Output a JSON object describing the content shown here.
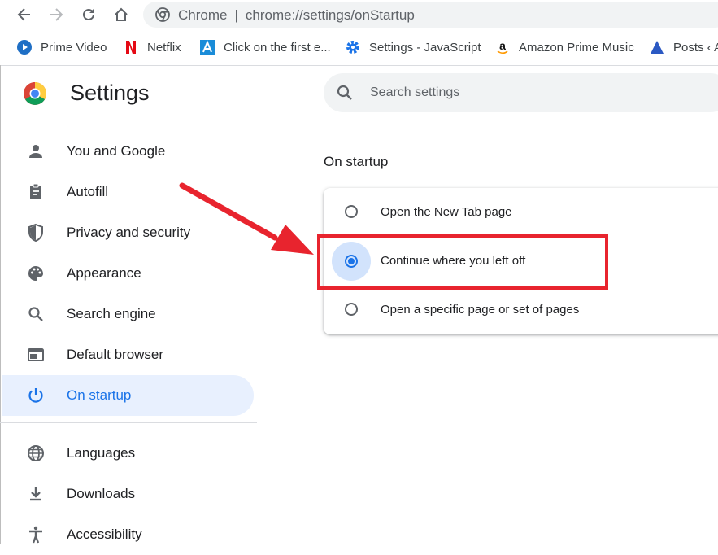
{
  "browser": {
    "omnibox": {
      "site_label": "Chrome",
      "separator": "|",
      "url": "chrome://settings/onStartup"
    },
    "bookmarks": [
      {
        "label": "Prime Video",
        "icon": "prime-video-icon"
      },
      {
        "label": "Netflix",
        "icon": "netflix-icon"
      },
      {
        "label": "Click on the first e...",
        "icon": "letter-a-icon"
      },
      {
        "label": "Settings - JavaScript",
        "icon": "gear-icon"
      },
      {
        "label": "Amazon Prime Music",
        "icon": "amazon-icon"
      },
      {
        "label": "Posts ‹ A",
        "icon": "triangle-icon"
      }
    ]
  },
  "settings": {
    "title": "Settings",
    "search_placeholder": "Search settings",
    "nav": [
      {
        "label": "You and Google",
        "icon": "person-icon",
        "active": false
      },
      {
        "label": "Autofill",
        "icon": "clipboard-icon",
        "active": false
      },
      {
        "label": "Privacy and security",
        "icon": "shield-icon",
        "active": false
      },
      {
        "label": "Appearance",
        "icon": "palette-icon",
        "active": false
      },
      {
        "label": "Search engine",
        "icon": "search-icon",
        "active": false
      },
      {
        "label": "Default browser",
        "icon": "browser-window-icon",
        "active": false
      },
      {
        "label": "On startup",
        "icon": "power-icon",
        "active": true
      },
      {
        "label": "Languages",
        "icon": "globe-icon",
        "active": false
      },
      {
        "label": "Downloads",
        "icon": "download-icon",
        "active": false
      },
      {
        "label": "Accessibility",
        "icon": "accessibility-icon",
        "active": false
      }
    ]
  },
  "startup": {
    "section_title": "On startup",
    "options": [
      {
        "label": "Open the New Tab page",
        "selected": false
      },
      {
        "label": "Continue where you left off",
        "selected": true
      },
      {
        "label": "Open a specific page or set of pages",
        "selected": false
      }
    ]
  },
  "colors": {
    "accent": "#1a73e8",
    "active_nav_bg": "#e8f0fe",
    "annotation_red": "#e8242e"
  }
}
